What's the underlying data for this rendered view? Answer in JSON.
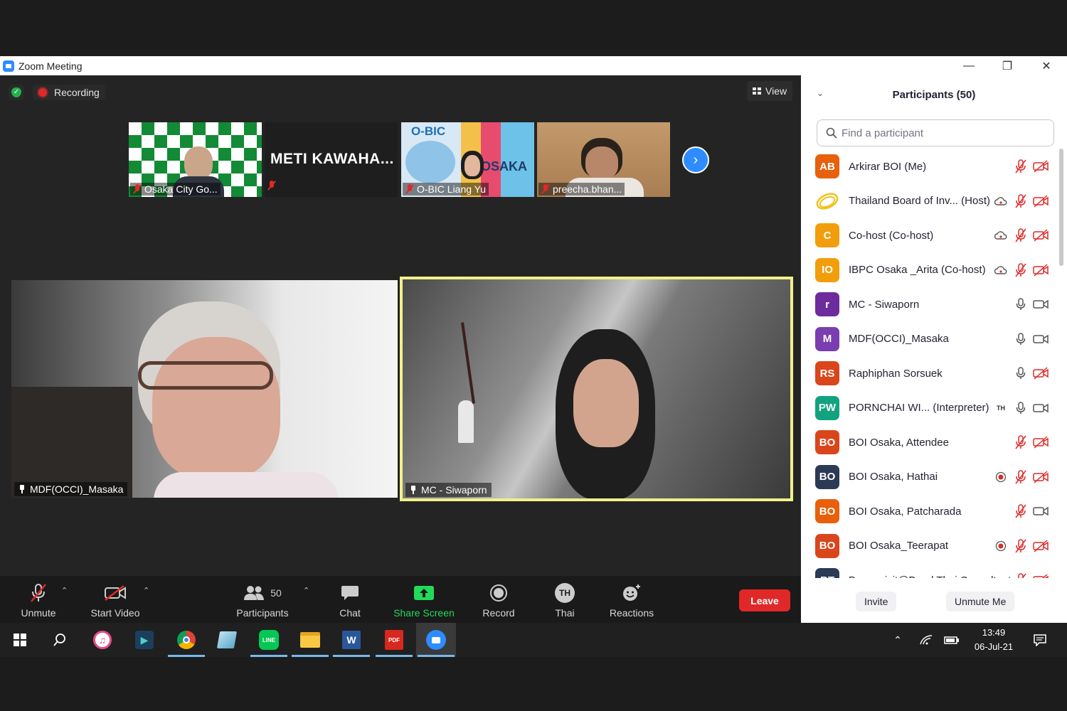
{
  "window": {
    "title": "Zoom Meeting"
  },
  "meeting": {
    "recording_label": "Recording",
    "view_label": "View",
    "thumbnails": [
      {
        "name": "Osaka City Go..."
      },
      {
        "name": "METI  KAWAHA..."
      },
      {
        "name": "O-BIC Liang Yu",
        "logo_text": "O-BIC",
        "banner_text": "OSAKA"
      },
      {
        "name": "preecha.bhan..."
      }
    ],
    "videos": [
      {
        "name": "MDF(OCCI)_Masaka"
      },
      {
        "name": "MC - Siwaporn"
      }
    ]
  },
  "toolbar": {
    "unmute": "Unmute",
    "start_video": "Start Video",
    "participants_count": "50",
    "participants": "Participants",
    "chat": "Chat",
    "share_screen": "Share Screen",
    "record": "Record",
    "language_badge": "TH",
    "language": "Thai",
    "reactions": "Reactions",
    "leave": "Leave"
  },
  "panel": {
    "title": "Participants (50)",
    "search_placeholder": "Find a participant",
    "invite": "Invite",
    "unmute_me": "Unmute Me",
    "participants": [
      {
        "initials": "AB",
        "name": "Arkirar BOI (Me)",
        "color": "#e8600c",
        "mic": "muted",
        "video": "off"
      },
      {
        "initials": "",
        "name": "Thailand Board of Inv... (Host)",
        "color": "#f2c11b",
        "mic": "muted",
        "video": "off",
        "cloud": true
      },
      {
        "initials": "C",
        "name": "Co-host (Co-host)",
        "color": "#f29e0c",
        "mic": "muted",
        "video": "off",
        "cloud": true
      },
      {
        "initials": "IO",
        "name": "IBPC Osaka _Arita (Co-host)",
        "color": "#f29e0c",
        "mic": "muted",
        "video": "off",
        "cloud": true
      },
      {
        "initials": "r",
        "name": "MC - Siwaporn",
        "color": "#6e2b9e",
        "mic": "on",
        "video": "on"
      },
      {
        "initials": "M",
        "name": "MDF(OCCI)_Masaka",
        "color": "#7a3eb0",
        "mic": "on",
        "video": "on"
      },
      {
        "initials": "RS",
        "name": "Raphiphan Sorsuek",
        "color": "#d9461c",
        "mic": "on",
        "video": "off"
      },
      {
        "initials": "PW",
        "name": "PORNCHAI WI...  (Interpreter)",
        "color": "#12a37e",
        "mic": "on",
        "video": "on",
        "lang": "TH"
      },
      {
        "initials": "BO",
        "name": "BOI Osaka, Attendee",
        "color": "#d9461c",
        "mic": "muted",
        "video": "off"
      },
      {
        "initials": "BO",
        "name": "BOI Osaka, Hathai",
        "color": "#2b3a55",
        "mic": "muted",
        "video": "off",
        "rec": true
      },
      {
        "initials": "BO",
        "name": "BOI Osaka, Patcharada",
        "color": "#e8600c",
        "mic": "muted",
        "video": "on"
      },
      {
        "initials": "BO",
        "name": "BOI Osaka_Teerapat",
        "color": "#d9461c",
        "mic": "muted",
        "video": "off",
        "rec": true
      },
      {
        "initials": "BT",
        "name": "Benyapisit@Bond Thai Consultant",
        "color": "#2b3a55",
        "mic": "muted",
        "video": "off"
      }
    ]
  },
  "taskbar": {
    "time": "13:49",
    "date": "06-Jul-21",
    "pdf_label": "PDF"
  },
  "colors": {
    "accent": "#2d8cff",
    "leave": "#e02828",
    "share_green": "#23d959",
    "active_speaker": "#f2f08a",
    "muted_red": "#e02828"
  }
}
